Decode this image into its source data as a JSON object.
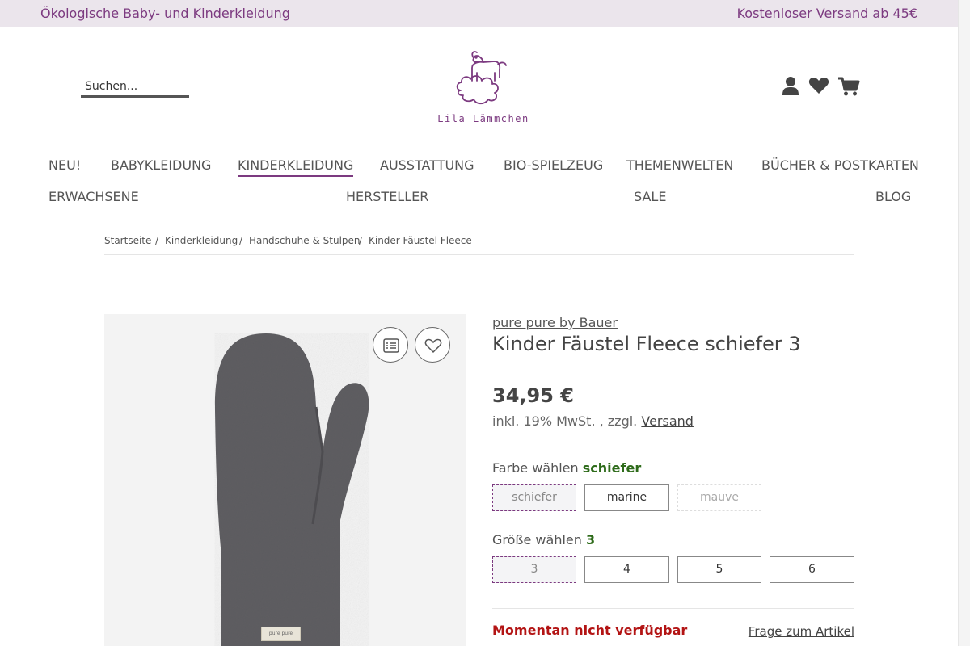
{
  "topbar": {
    "left_text": "Ökologische Baby- und Kinderkleidung",
    "right_text": "Kostenloser Versand ab 45€"
  },
  "header": {
    "search_placeholder": "Suchen...",
    "logo_text": "Lila Lämmchen",
    "icons": [
      "account-icon",
      "heart-icon",
      "cart-icon"
    ]
  },
  "nav": {
    "items": [
      "NEU!",
      "BABYKLEIDUNG",
      "KINDERKLEIDUNG",
      "AUSSTATTUNG",
      "BIO-SPIELZEUG",
      "THEMENWELTEN",
      "BÜCHER & POSTKARTEN",
      "ERWACHSENE",
      "HERSTELLER",
      "SALE",
      "BLOG"
    ],
    "active": "KINDERKLEIDUNG"
  },
  "breadcrumb": {
    "items": [
      "Startseite",
      "Kinderkleidung",
      "Handschuhe & Stulpen",
      "Kinder Fäustel Fleece"
    ],
    "separator": "/"
  },
  "product": {
    "brand": "pure pure by Bauer",
    "title": "Kinder Fäustel Fleece schiefer 3",
    "price": "34,95 €",
    "tax_text": "inkl. 19% MwSt. , zzgl.",
    "shipping_link": "Versand",
    "label_text": "pure pure",
    "color": {
      "label": "Farbe wählen",
      "selected": "schiefer",
      "options": [
        "schiefer",
        "marine",
        "mauve"
      ]
    },
    "size": {
      "label": "Größe wählen",
      "selected": "3",
      "options": [
        "3",
        "4",
        "5",
        "6"
      ]
    },
    "availability": "Momentan nicht verfügbar",
    "question_link": "Frage zum Artikel"
  },
  "colors": {
    "accent": "#7c3a80",
    "topbar_bg": "#ebe5ec",
    "selected_value": "#2e6b1a",
    "unavailable": "#b31414"
  }
}
